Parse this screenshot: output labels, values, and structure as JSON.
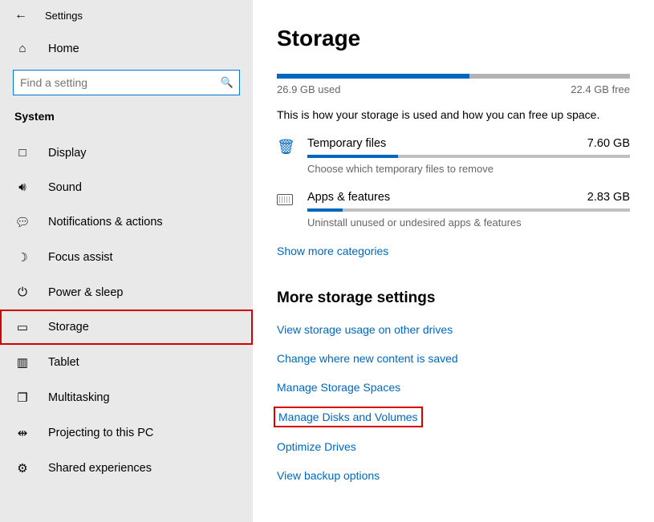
{
  "header": {
    "title": "Settings"
  },
  "nav": {
    "home": "Home",
    "search_placeholder": "Find a setting",
    "group": "System",
    "items": [
      {
        "label": "Display"
      },
      {
        "label": "Sound"
      },
      {
        "label": "Notifications & actions"
      },
      {
        "label": "Focus assist"
      },
      {
        "label": "Power & sleep"
      },
      {
        "label": "Storage"
      },
      {
        "label": "Tablet"
      },
      {
        "label": "Multitasking"
      },
      {
        "label": "Projecting to this PC"
      },
      {
        "label": "Shared experiences"
      }
    ]
  },
  "main": {
    "title": "Storage",
    "used_label": "26.9 GB used",
    "free_label": "22.4 GB free",
    "used_pct": 54.6,
    "description": "This is how your storage is used and how you can free up space.",
    "categories": [
      {
        "title": "Temporary files",
        "size": "7.60 GB",
        "sub": "Choose which temporary files to remove",
        "pct": 28
      },
      {
        "title": "Apps & features",
        "size": "2.83 GB",
        "sub": "Uninstall unused or undesired apps & features",
        "pct": 11
      }
    ],
    "show_more": "Show more categories",
    "more_title": "More storage settings",
    "more_links": [
      "View storage usage on other drives",
      "Change where new content is saved",
      "Manage Storage Spaces",
      "Manage Disks and Volumes",
      "Optimize Drives",
      "View backup options"
    ]
  }
}
